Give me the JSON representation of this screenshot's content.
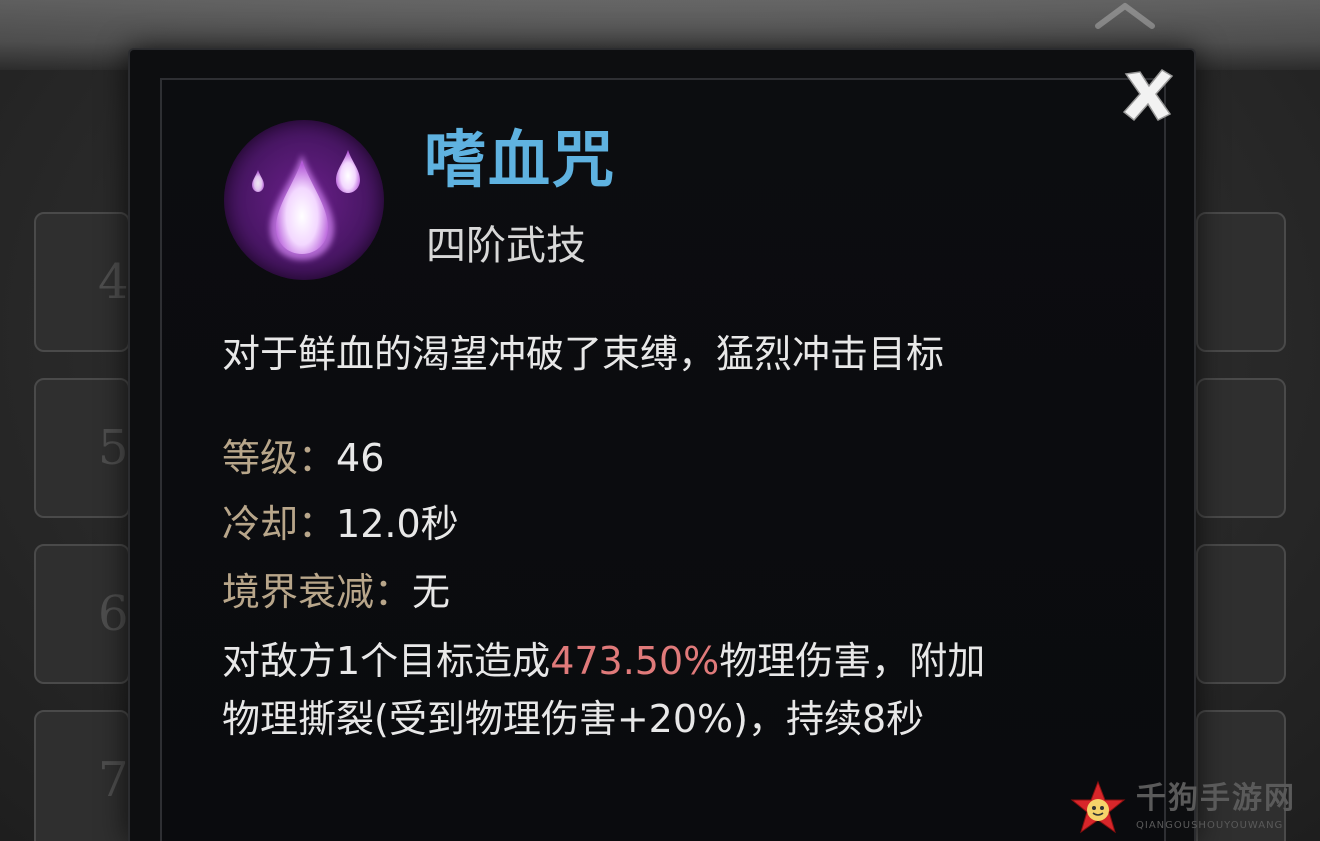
{
  "background": {
    "slot_numbers": [
      "4",
      "5",
      "6",
      "7"
    ]
  },
  "tooltip": {
    "close_icon": "close-icon",
    "skill_icon": "blood-drop-icon",
    "skill_name": "嗜血咒",
    "skill_rank": "四阶武技",
    "description": "对于鲜血的渴望冲破了束缚，猛烈冲击目标",
    "stats": [
      {
        "label": "等级：",
        "value": "46"
      },
      {
        "label": "冷却：",
        "value": "12.0秒"
      },
      {
        "label": "境界衰减：",
        "value": "无"
      }
    ],
    "effect": {
      "line1_prefix": "对敌方1个目标造成",
      "line1_highlight": "473.50%",
      "line1_suffix": "物理伤害，附加",
      "line2": "物理撕裂(受到物理伤害+20%)，持续8秒"
    },
    "colors": {
      "skill_name": "#5fb2e0",
      "stat_label": "#b8a68a",
      "highlight": "#e07a7a",
      "icon_bg": "#4a1766"
    }
  },
  "watermark": {
    "cn": "千狗手游网",
    "en": "QIANGOUSHOUYOUWANG"
  }
}
